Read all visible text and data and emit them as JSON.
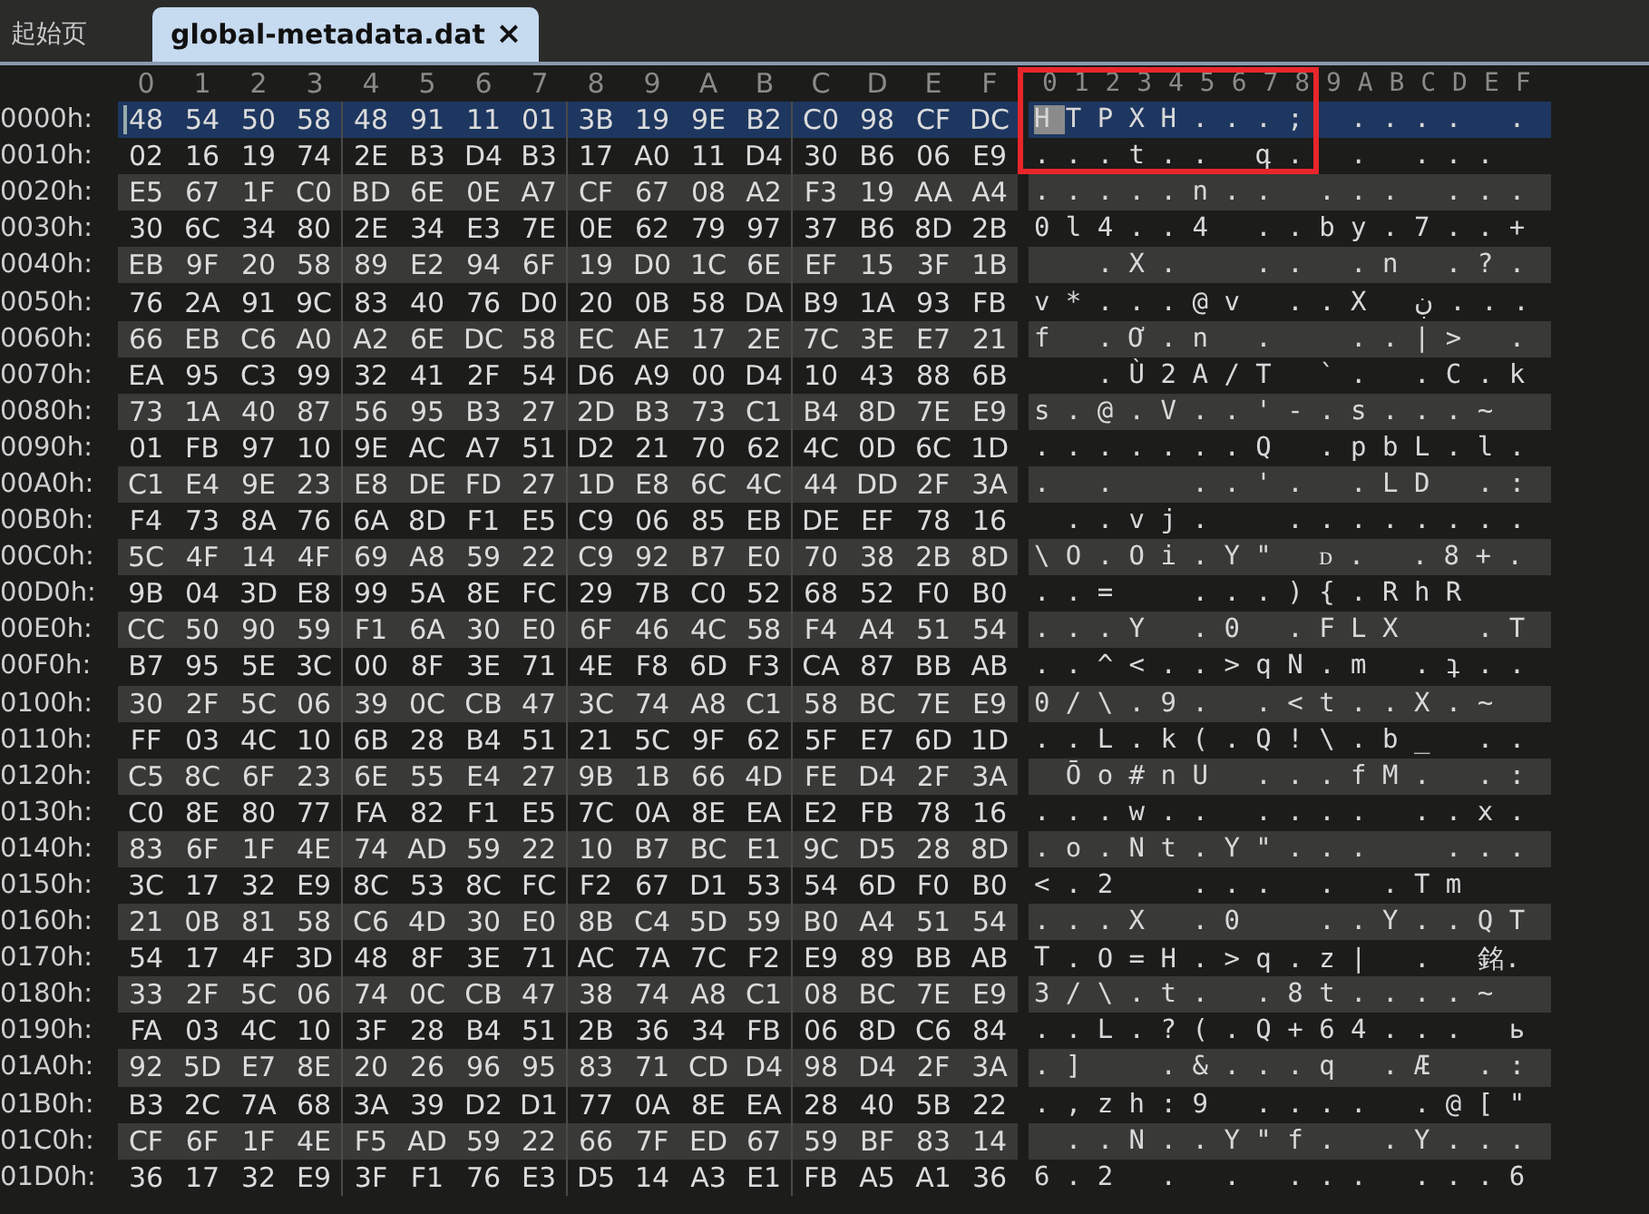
{
  "tabs": [
    {
      "label": "起始页",
      "selected": false
    },
    {
      "label": "global-metadata.dat",
      "selected": true,
      "close": "×"
    }
  ],
  "hex_columns": [
    "0",
    "1",
    "2",
    "3",
    "4",
    "5",
    "6",
    "7",
    "8",
    "9",
    "A",
    "B",
    "C",
    "D",
    "E",
    "F"
  ],
  "ascii_columns": [
    "0",
    "1",
    "2",
    "3",
    "4",
    "5",
    "6",
    "7",
    "8",
    "9",
    "A",
    "B",
    "C",
    "D",
    "E",
    "F"
  ],
  "rows": [
    {
      "offset": "0000h:",
      "bytes": [
        "48",
        "54",
        "50",
        "58",
        "48",
        "91",
        "11",
        "01",
        "3B",
        "19",
        "9E",
        "B2",
        "C0",
        "98",
        "CF",
        "DC"
      ],
      "ascii_first": "H",
      "ascii": "T P X H . . . ;   . . . .   .",
      "selected": true
    },
    {
      "offset": "0010h:",
      "bytes": [
        "02",
        "16",
        "19",
        "74",
        "2E",
        "B3",
        "D4",
        "B3",
        "17",
        "A0",
        "11",
        "D4",
        "30",
        "B6",
        "06",
        "E9"
      ],
      "ascii_first": ".",
      "ascii": ". . t . .   գ .   .   . . .",
      "selected": false
    },
    {
      "offset": "0020h:",
      "bytes": [
        "E5",
        "67",
        "1F",
        "C0",
        "BD",
        "6E",
        "0E",
        "A7",
        "CF",
        "67",
        "08",
        "A2",
        "F3",
        "19",
        "AA",
        "A4"
      ],
      "ascii_first": ".",
      "ascii": ". . . . n . .   . . .   . . .",
      "selected": false
    },
    {
      "offset": "0030h:",
      "bytes": [
        "30",
        "6C",
        "34",
        "80",
        "2E",
        "34",
        "E3",
        "7E",
        "0E",
        "62",
        "79",
        "97",
        "37",
        "B6",
        "8D",
        "2B"
      ],
      "ascii_first": "0",
      "ascii": "l 4 . . 4   . . b y . 7 . . +",
      "selected": false
    },
    {
      "offset": "0040h:",
      "bytes": [
        "EB",
        "9F",
        "20",
        "58",
        "89",
        "E2",
        "94",
        "6F",
        "19",
        "D0",
        "1C",
        "6E",
        "EF",
        "15",
        "3F",
        "1B"
      ],
      "ascii": "  . X .     . .   . n   . ? .",
      "selected": false
    },
    {
      "offset": "0050h:",
      "bytes": [
        "76",
        "2A",
        "91",
        "9C",
        "83",
        "40",
        "76",
        "D0",
        "20",
        "0B",
        "58",
        "DA",
        "B9",
        "1A",
        "93",
        "FB"
      ],
      "ascii_first": "v",
      "ascii": "* . . . @ v   . . X   ڹ . . .",
      "selected": false
    },
    {
      "offset": "0060h:",
      "bytes": [
        "66",
        "EB",
        "C6",
        "A0",
        "A2",
        "6E",
        "DC",
        "58",
        "EC",
        "AE",
        "17",
        "2E",
        "7C",
        "3E",
        "E7",
        "21"
      ],
      "ascii_first": "f",
      "ascii": "  . Ơ . n   .     . . | >   .",
      "selected": false
    },
    {
      "offset": "0070h:",
      "bytes": [
        "EA",
        "95",
        "C3",
        "99",
        "32",
        "41",
        "2F",
        "54",
        "D6",
        "A9",
        "00",
        "D4",
        "10",
        "43",
        "88",
        "6B"
      ],
      "ascii": "  . Ù 2 A / T   ` .   . C . k",
      "selected": false
    },
    {
      "offset": "0080h:",
      "bytes": [
        "73",
        "1A",
        "40",
        "87",
        "56",
        "95",
        "B3",
        "27",
        "2D",
        "B3",
        "73",
        "C1",
        "B4",
        "8D",
        "7E",
        "E9"
      ],
      "ascii_first": "s",
      "ascii": ". @ . V . . ' - . s . . . ~",
      "selected": false
    },
    {
      "offset": "0090h:",
      "bytes": [
        "01",
        "FB",
        "97",
        "10",
        "9E",
        "AC",
        "A7",
        "51",
        "D2",
        "21",
        "70",
        "62",
        "4C",
        "0D",
        "6C",
        "1D"
      ],
      "ascii_first": ".",
      "ascii": ". . . . . . Q   . p b L . l .",
      "selected": false
    },
    {
      "offset": "00A0h:",
      "bytes": [
        "C1",
        "E4",
        "9E",
        "23",
        "E8",
        "DE",
        "FD",
        "27",
        "1D",
        "E8",
        "6C",
        "4C",
        "44",
        "DD",
        "2F",
        "3A"
      ],
      "ascii_first": ".",
      "ascii": "  .     . . ' .   . L D   . :",
      "selected": false
    },
    {
      "offset": "00B0h:",
      "bytes": [
        "F4",
        "73",
        "8A",
        "76",
        "6A",
        "8D",
        "F1",
        "E5",
        "C9",
        "06",
        "85",
        "EB",
        "DE",
        "EF",
        "78",
        "16"
      ],
      "ascii": ". . v j .     . . . . . . . .",
      "selected": false
    },
    {
      "offset": "00C0h:",
      "bytes": [
        "5C",
        "4F",
        "14",
        "4F",
        "69",
        "A8",
        "59",
        "22",
        "C9",
        "92",
        "B7",
        "E0",
        "70",
        "38",
        "2B",
        "8D"
      ],
      "ascii_first": "\\",
      "ascii": "O . O i . Y \"   ᴅ .   . 8 + .",
      "selected": false
    },
    {
      "offset": "00D0h:",
      "bytes": [
        "9B",
        "04",
        "3D",
        "E8",
        "99",
        "5A",
        "8E",
        "FC",
        "29",
        "7B",
        "C0",
        "52",
        "68",
        "52",
        "F0",
        "B0"
      ],
      "ascii_first": ".",
      "ascii": ". =     . . . ) { . R h R",
      "selected": false
    },
    {
      "offset": "00E0h:",
      "bytes": [
        "CC",
        "50",
        "90",
        "59",
        "F1",
        "6A",
        "30",
        "E0",
        "6F",
        "46",
        "4C",
        "58",
        "F4",
        "A4",
        "51",
        "54"
      ],
      "ascii_first": ".",
      "ascii": ". . Y   . 0   . F L X     . T",
      "selected": false
    },
    {
      "offset": "00F0h:",
      "bytes": [
        "B7",
        "95",
        "5E",
        "3C",
        "00",
        "8F",
        "3E",
        "71",
        "4E",
        "F8",
        "6D",
        "F3",
        "CA",
        "87",
        "BB",
        "AB"
      ],
      "ascii_first": ".",
      "ascii": ". ^ < . . > q N . m   . ʇ . .",
      "selected": false
    },
    {
      "offset": "0100h:",
      "bytes": [
        "30",
        "2F",
        "5C",
        "06",
        "39",
        "0C",
        "CB",
        "47",
        "3C",
        "74",
        "A8",
        "C1",
        "58",
        "BC",
        "7E",
        "E9"
      ],
      "ascii_first": "0",
      "ascii": "/ \\ . 9 .   . < t . . X . ~",
      "selected": false
    },
    {
      "offset": "0110h:",
      "bytes": [
        "FF",
        "03",
        "4C",
        "10",
        "6B",
        "28",
        "B4",
        "51",
        "21",
        "5C",
        "9F",
        "62",
        "5F",
        "E7",
        "6D",
        "1D"
      ],
      "ascii_first": ".",
      "ascii": ". L . k ( . Q ! \\ . b _   . .",
      "selected": false
    },
    {
      "offset": "0120h:",
      "bytes": [
        "C5",
        "8C",
        "6F",
        "23",
        "6E",
        "55",
        "E4",
        "27",
        "9B",
        "1B",
        "66",
        "4D",
        "FE",
        "D4",
        "2F",
        "3A"
      ],
      "ascii": "Ō o # n U   . . . f M .   . :",
      "selected": false
    },
    {
      "offset": "0130h:",
      "bytes": [
        "C0",
        "8E",
        "80",
        "77",
        "FA",
        "82",
        "F1",
        "E5",
        "7C",
        "0A",
        "8E",
        "EA",
        "E2",
        "FB",
        "78",
        "16"
      ],
      "ascii_first": ".",
      "ascii": ". . w . .   . . . .   . . x .",
      "selected": false
    },
    {
      "offset": "0140h:",
      "bytes": [
        "83",
        "6F",
        "1F",
        "4E",
        "74",
        "AD",
        "59",
        "22",
        "10",
        "B7",
        "BC",
        "E1",
        "9C",
        "D5",
        "28",
        "8D"
      ],
      "ascii_first": ".",
      "ascii": "o . N t . Y \" . . .     . . .",
      "selected": false
    },
    {
      "offset": "0150h:",
      "bytes": [
        "3C",
        "17",
        "32",
        "E9",
        "8C",
        "53",
        "8C",
        "FC",
        "F2",
        "67",
        "D1",
        "53",
        "54",
        "6D",
        "F0",
        "B0"
      ],
      "ascii_first": "<",
      "ascii": ". 2     . . .   .   . T m",
      "selected": false
    },
    {
      "offset": "0160h:",
      "bytes": [
        "21",
        "0B",
        "81",
        "58",
        "C6",
        "4D",
        "30",
        "E0",
        "8B",
        "C4",
        "5D",
        "59",
        "B0",
        "A4",
        "51",
        "54"
      ],
      "ascii_first": ".",
      "ascii": ". . X   . 0     . . Y . . Q T",
      "selected": false
    },
    {
      "offset": "0170h:",
      "bytes": [
        "54",
        "17",
        "4F",
        "3D",
        "48",
        "8F",
        "3E",
        "71",
        "AC",
        "7A",
        "7C",
        "F2",
        "E9",
        "89",
        "BB",
        "AB"
      ],
      "ascii_first": "T",
      "ascii": ". O = H . > q . z |   .   銘.",
      "selected": false
    },
    {
      "offset": "0180h:",
      "bytes": [
        "33",
        "2F",
        "5C",
        "06",
        "74",
        "0C",
        "CB",
        "47",
        "38",
        "74",
        "A8",
        "C1",
        "08",
        "BC",
        "7E",
        "E9"
      ],
      "ascii_first": "3",
      "ascii": "/ \\ . t .   . 8 t . . . . ~",
      "selected": false
    },
    {
      "offset": "0190h:",
      "bytes": [
        "FA",
        "03",
        "4C",
        "10",
        "3F",
        "28",
        "B4",
        "51",
        "2B",
        "36",
        "34",
        "FB",
        "06",
        "8D",
        "C6",
        "84"
      ],
      "ascii_first": ".",
      "ascii": ". L . ? ( . Q + 6 4 . . .   ь",
      "selected": false
    },
    {
      "offset": "01A0h:",
      "bytes": [
        "92",
        "5D",
        "E7",
        "8E",
        "20",
        "26",
        "96",
        "95",
        "83",
        "71",
        "CD",
        "D4",
        "98",
        "D4",
        "2F",
        "3A"
      ],
      "ascii_first": ".",
      "ascii": "]     . & . . . q   . Æ   . :",
      "selected": false
    },
    {
      "offset": "01B0h:",
      "bytes": [
        "B3",
        "2C",
        "7A",
        "68",
        "3A",
        "39",
        "D2",
        "D1",
        "77",
        "0A",
        "8E",
        "EA",
        "28",
        "40",
        "5B",
        "22"
      ],
      "ascii_first": ".",
      "ascii": ", z h : 9   . . . .   . @ [ \"",
      "selected": false
    },
    {
      "offset": "01C0h:",
      "bytes": [
        "CF",
        "6F",
        "1F",
        "4E",
        "F5",
        "AD",
        "59",
        "22",
        "66",
        "7F",
        "ED",
        "67",
        "59",
        "BF",
        "83",
        "14"
      ],
      "ascii": ". . N . . Y \" f .   . Y . . .",
      "selected": false
    },
    {
      "offset": "01D0h:",
      "bytes": [
        "36",
        "17",
        "32",
        "E9",
        "3F",
        "F1",
        "76",
        "E3",
        "D5",
        "14",
        "A3",
        "E1",
        "FB",
        "A5",
        "A1",
        "36"
      ],
      "ascii_first": "6",
      "ascii": ". 2   .   .   . . .   . . . 6",
      "selected": false
    }
  ]
}
